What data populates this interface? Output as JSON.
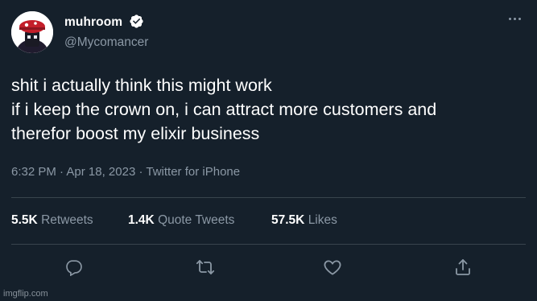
{
  "author": {
    "display_name": "muhroom",
    "handle": "@Mycomancer",
    "verified": true,
    "avatar": "avatar-image",
    "menu_icon": "more-options-icon"
  },
  "tweet": {
    "lines": [
      "shit i actually think this might work",
      "if i keep the crown on, i can attract more customers and",
      "therefor boost my elixir business"
    ],
    "time": "6:32 PM",
    "date": "Apr 18, 2023",
    "source": "Twitter for iPhone",
    "separator": "·"
  },
  "stats": {
    "retweets": {
      "count": "5.5K",
      "label": "Retweets"
    },
    "quote_tweets": {
      "count": "1.4K",
      "label": "Quote Tweets"
    },
    "likes": {
      "count": "57.5K",
      "label": "Likes"
    }
  },
  "actions": [
    "reply-icon",
    "retweet-icon",
    "like-icon",
    "share-icon"
  ],
  "watermark": "imgflip.com",
  "colors": {
    "background": "#15202b",
    "text": "#ffffff",
    "secondary": "#8b98a5",
    "verified": "#1d9bf0",
    "divider": "#38444d"
  }
}
